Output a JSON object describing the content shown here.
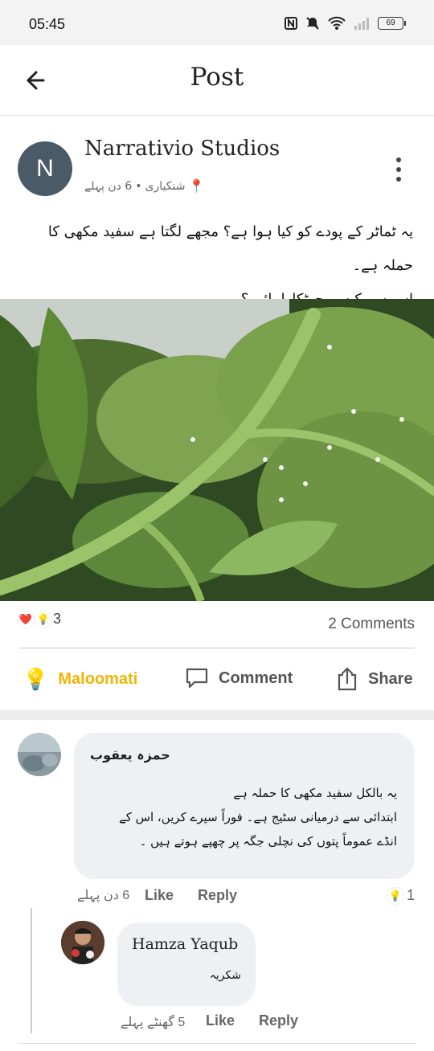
{
  "status_bar": {
    "time": "05:45",
    "battery": "69"
  },
  "header": {
    "title": "Post"
  },
  "post": {
    "author": "Narrativio Studios",
    "avatar_letter": "N",
    "location": "شنکیاری",
    "time_ago": "6 دن پہلے",
    "separator": "•",
    "text_line1": "یہ ٹماٹر کے پودے کو کیا ہوا ہے؟ مجھے لگتا ہے سفید مکھی کا حملہ ہے۔",
    "text_line2": "اس سے کیسے چھٹکارا پائیں؟",
    "reaction_count": "3",
    "comments_label": "2 Comments"
  },
  "actions": {
    "maloomati": "Maloomati",
    "comment": "Comment",
    "share": "Share"
  },
  "comments": [
    {
      "author": "حمزہ یعقوب",
      "line1": "یہ بالکل سفید مکھی کا حملہ ہے",
      "line2": "ابتدائی سے درمیانی سٹیج ہے۔ فوراً سپرے کریں، اس کے",
      "line3": "انڈے عموماً پتوں کی نچلی جگہ پر چھپے ہوتے ہیں ۔",
      "time_ago": "6 دن پہلے",
      "like": "Like",
      "reply": "Reply",
      "reaction_count": "1"
    }
  ],
  "replies": [
    {
      "author": "Hamza Yaqub",
      "text": "شکریہ",
      "time_ago": "5 گھنٹے پہلے",
      "like": "Like",
      "reply": "Reply"
    }
  ],
  "colors": {
    "accent": "#f2b400",
    "avatar_bg": "#4a5a66",
    "bubble_bg": "#eef0f4"
  }
}
